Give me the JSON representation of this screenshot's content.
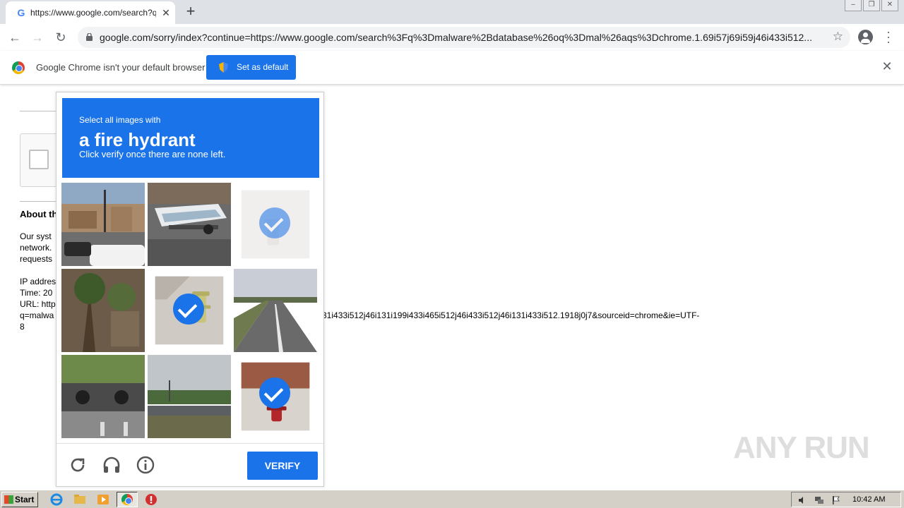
{
  "browser": {
    "tab_title": "https://www.google.com/search?q=",
    "tab_favicon": "G",
    "tab_close": "✕",
    "new_tab": "+",
    "url": "google.com/sorry/index?continue=https://www.google.com/search%3Fq%3Dmalware%2Bdatabase%26oq%3Dmal%26aqs%3Dchrome.1.69i57j69i59j46i433i512...",
    "window_buttons": [
      "minimize",
      "restore",
      "close"
    ]
  },
  "infobar": {
    "message": "Google Chrome isn't your default browser",
    "set_default_label": "Set as default",
    "close": "✕"
  },
  "sorry_page": {
    "about_heading": "About th",
    "lines": [
      "Our syst",
      "network.",
      "requests",
      "",
      "IP addres",
      "Time: 20",
      "URL: http",
      "q=malwa",
      "8"
    ],
    "url_tail": "31i433i512j46i131i199i433i465i512j46i433i512j46i131i433i512.1918j0j7&sourceid=chrome&ie=UTF-"
  },
  "captcha": {
    "instruction_small": "Select all images with",
    "target": "a fire hydrant",
    "instruction_sub": "Click verify once there are none left.",
    "tiles": [
      {
        "scene": "street-intersection",
        "selected": false
      },
      {
        "scene": "boat-trailer",
        "selected": false
      },
      {
        "scene": "fire-hydrant-faded",
        "selected": true,
        "fading": true
      },
      {
        "scene": "palm-trees",
        "selected": false
      },
      {
        "scene": "fire-hydrant-sidewalk",
        "selected": true
      },
      {
        "scene": "highway",
        "selected": false
      },
      {
        "scene": "parked-motorcycles",
        "selected": false
      },
      {
        "scene": "railing-field",
        "selected": false
      },
      {
        "scene": "red-fire-hydrant",
        "selected": true
      }
    ],
    "verify_label": "VERIFY",
    "icons": [
      "reload-icon",
      "audio-icon",
      "info-icon"
    ],
    "colors": {
      "accent": "#1a73e8"
    }
  },
  "watermark": "ANY RUN",
  "taskbar": {
    "start_label": "Start",
    "clock": "10:42 AM"
  }
}
